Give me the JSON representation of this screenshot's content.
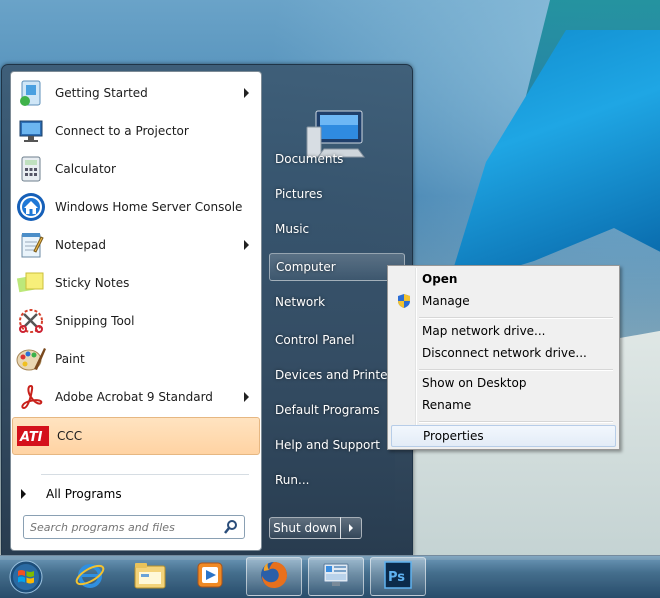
{
  "start_menu": {
    "programs": [
      {
        "label": "Getting Started",
        "icon": "getting-started-icon",
        "submenu": true
      },
      {
        "label": "Connect to a Projector",
        "icon": "projector-icon",
        "submenu": false
      },
      {
        "label": "Calculator",
        "icon": "calculator-icon",
        "submenu": false
      },
      {
        "label": "Windows Home Server Console",
        "icon": "home-server-icon",
        "submenu": false
      },
      {
        "label": "Notepad",
        "icon": "notepad-icon",
        "submenu": true
      },
      {
        "label": "Sticky Notes",
        "icon": "sticky-notes-icon",
        "submenu": false
      },
      {
        "label": "Snipping Tool",
        "icon": "snipping-tool-icon",
        "submenu": false
      },
      {
        "label": "Paint",
        "icon": "paint-icon",
        "submenu": false
      },
      {
        "label": "Adobe Acrobat 9 Standard",
        "icon": "acrobat-icon",
        "submenu": true
      },
      {
        "label": "CCC",
        "icon": "ati-icon",
        "submenu": false,
        "highlighted": true
      }
    ],
    "all_programs": "All Programs",
    "search": {
      "placeholder": "Search programs and files"
    },
    "right_links": [
      "Documents",
      "Pictures",
      "Music",
      "Computer",
      "Network",
      "Control Panel",
      "Devices and Printers",
      "Default Programs",
      "Help and Support",
      "Run..."
    ],
    "selected_right_link": "Computer",
    "shutdown_label": "Shut down"
  },
  "context_menu": {
    "items": [
      "Open",
      "Manage",
      "Map network drive...",
      "Disconnect network drive...",
      "Show on Desktop",
      "Rename",
      "Properties"
    ],
    "bold_item": "Open",
    "hovered_item": "Properties",
    "shield_icon_on": "Manage"
  },
  "taskbar": {
    "pinned": [
      "internet-explorer-icon",
      "windows-explorer-icon",
      "media-player-icon",
      "firefox-icon",
      "home-server-console-icon",
      "photoshop-icon"
    ],
    "active": [
      "firefox-icon",
      "home-server-console-icon",
      "photoshop-icon"
    ]
  },
  "colors": {
    "highlight_fill": "#ffd3a3",
    "menu_hover_border": "#b7cde8"
  }
}
